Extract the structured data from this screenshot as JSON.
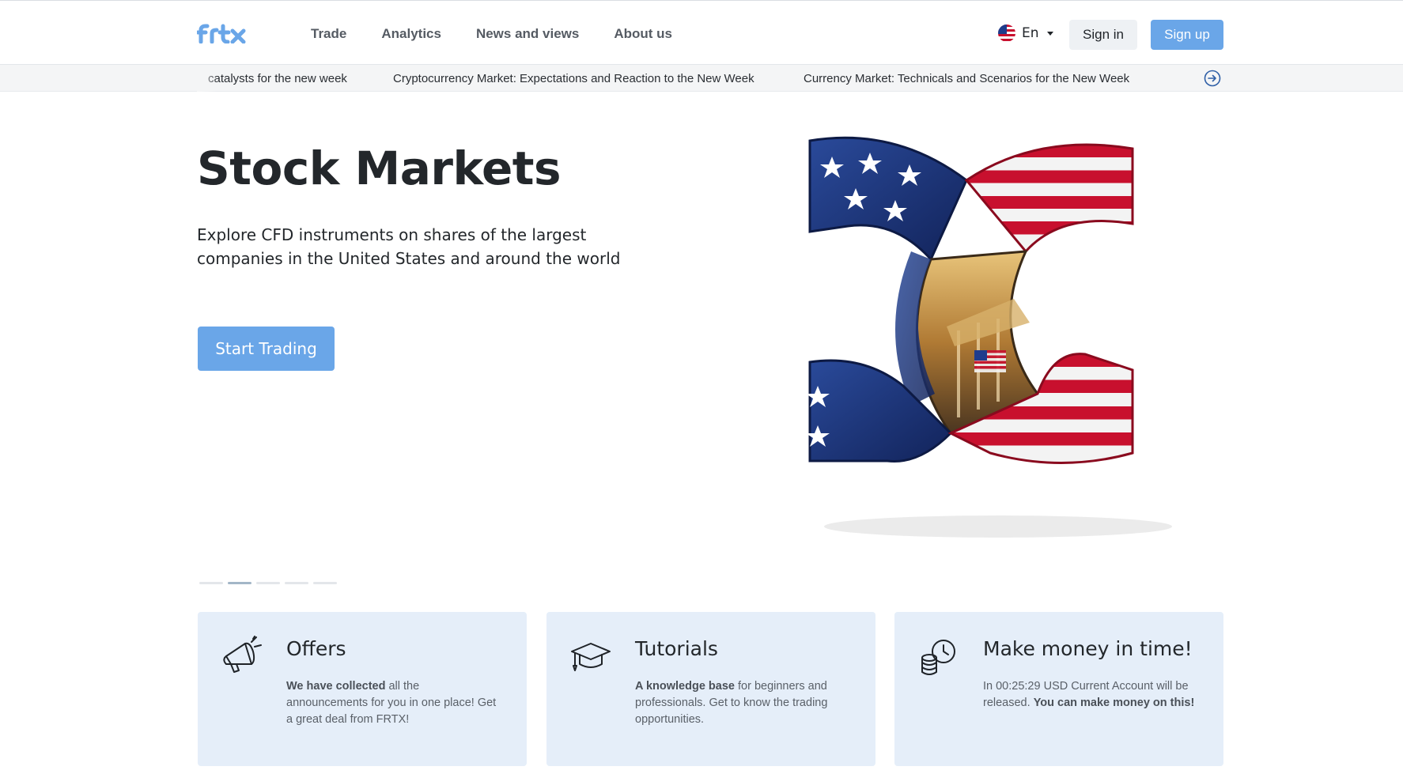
{
  "brand": {
    "logo_text": "frtx",
    "accent": "#6aa6e8",
    "card_bg": "#e5eef9"
  },
  "nav": {
    "items": [
      {
        "label": "Trade"
      },
      {
        "label": "Analytics"
      },
      {
        "label": "News and views"
      },
      {
        "label": "About us"
      }
    ]
  },
  "language": {
    "label": "En",
    "icon": "us-flag-icon"
  },
  "auth": {
    "sign_in_label": "Sign in",
    "sign_up_label": "Sign up"
  },
  "ticker": {
    "items": [
      {
        "text": "catalysts for the new week"
      },
      {
        "text": "Cryptocurrency Market: Expectations and Reaction to the New Week"
      },
      {
        "text": "Currency Market: Technicals and Scenarios for the New Week"
      }
    ],
    "next_icon": "arrow-right-circle-icon"
  },
  "hero": {
    "title": "Stock Markets",
    "subtitle": "Explore CFD instruments on shares of the largest companies in the United States and around the world",
    "cta_label": "Start Trading",
    "slides_count": 5,
    "active_slide": 2
  },
  "cards": [
    {
      "icon": "megaphone-icon",
      "title": "Offers",
      "text_bold_1": "We have collected",
      "text_1": " all the announcements for you in one place! Get a great deal from FRTX!"
    },
    {
      "icon": "graduation-cap-icon",
      "title": "Tutorials",
      "text_bold_1": "A knowledge base",
      "text_1": " for beginners and professionals. Get to know the trading opportunities."
    },
    {
      "icon": "coins-clock-icon",
      "title": "Make money in time!",
      "text_1": "In 00:25:29 USD Current Account will be released. ",
      "text_bold_1": "You can make money on this!"
    }
  ]
}
